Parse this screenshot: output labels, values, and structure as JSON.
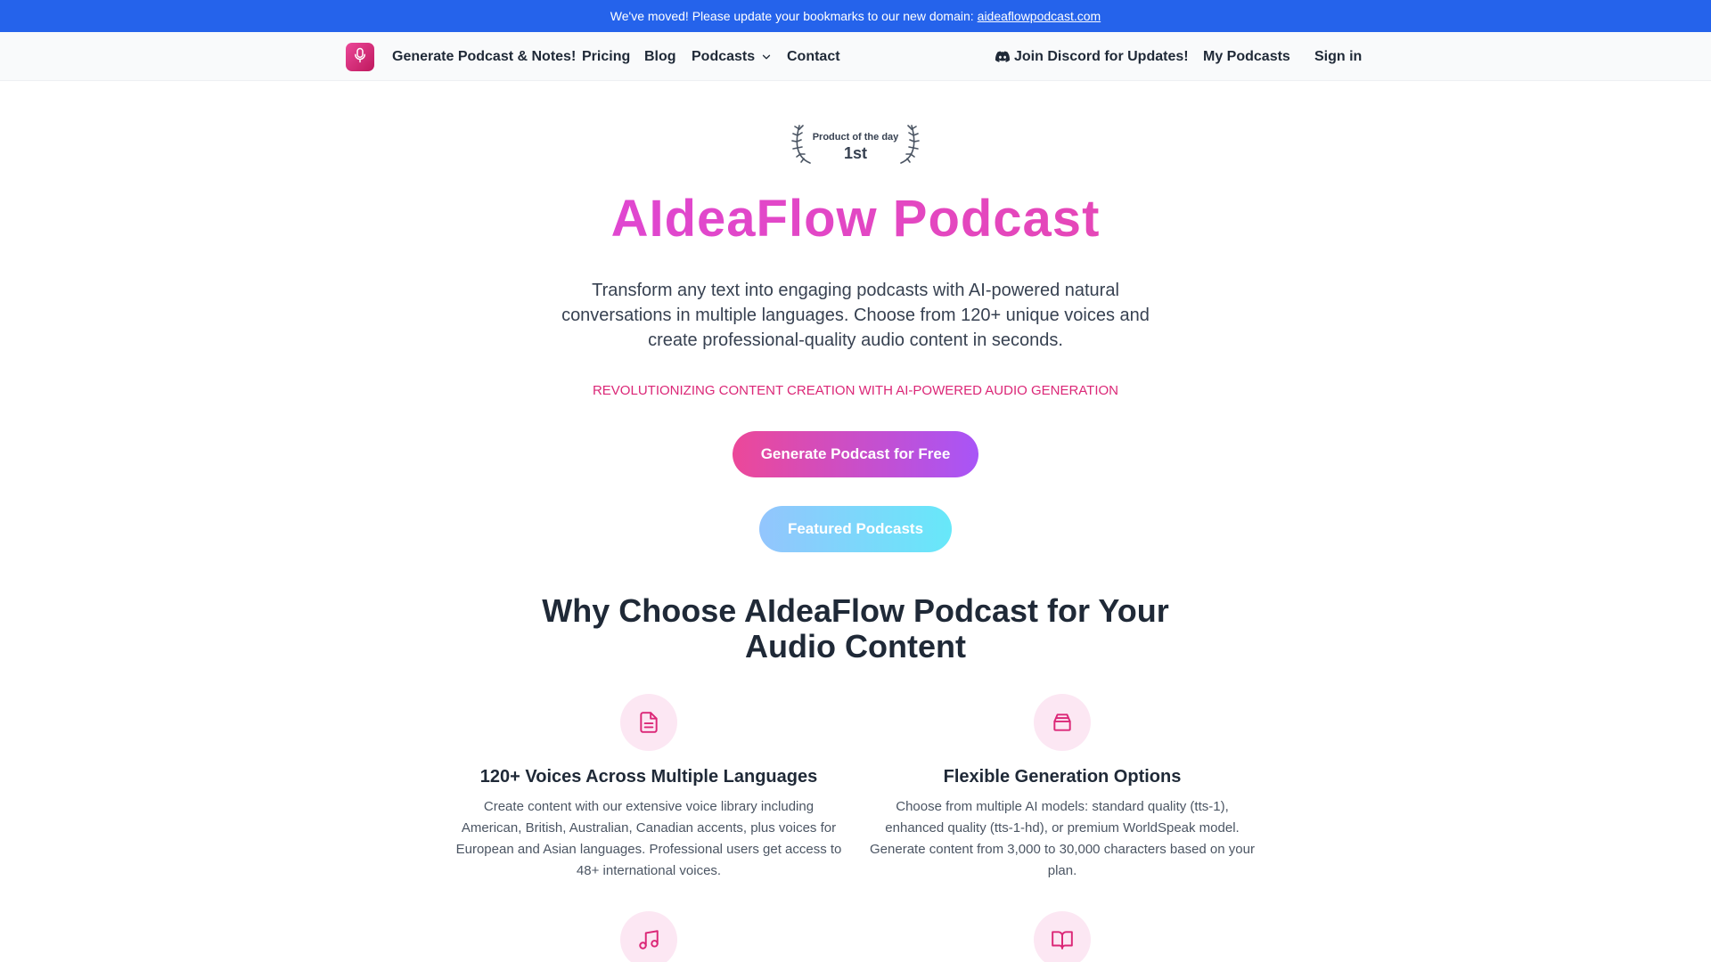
{
  "announcement": {
    "text": "We've moved! Please update your bookmarks to our new domain:",
    "link": "aideaflowpodcast.com"
  },
  "nav": {
    "logo_icon": "microphone-icon",
    "generate": "Generate Podcast & Notes!",
    "pricing": "Pricing",
    "blog": "Blog",
    "podcasts": "Podcasts",
    "contact": "Contact",
    "discord": "Join Discord for Updates!",
    "my_podcasts": "My Podcasts",
    "sign_in": "Sign in"
  },
  "badge": {
    "label": "Product of the day",
    "rank": "1st"
  },
  "hero": {
    "title": "AIdeaFlow Podcast",
    "subtitle": "Transform any text into engaging podcasts with AI-powered natural conversations in multiple languages. Choose from 120+ unique voices and create professional-quality audio content in seconds.",
    "tagline": "REVOLUTIONIZING CONTENT CREATION WITH AI-POWERED AUDIO GENERATION",
    "primary_button": "Generate Podcast for Free",
    "secondary_button": "Featured Podcasts"
  },
  "why": {
    "title": "Why Choose AIdeaFlow Podcast for Your Audio Content"
  },
  "features": [
    {
      "icon": "document-icon",
      "title": "120+ Voices Across Multiple Languages",
      "description": "Create content with our extensive voice library including American, British, Australian, Canadian accents, plus voices for European and Asian languages. Professional users get access to 48+ international voices."
    },
    {
      "icon": "inbox-icon",
      "title": "Flexible Generation Options",
      "description": "Choose from multiple AI models: standard quality (tts-1), enhanced quality (tts-1-hd), or premium WorldSpeak model. Generate content from 3,000 to 30,000 characters based on your plan."
    },
    {
      "icon": "music-note-icon"
    },
    {
      "icon": "open-book-icon"
    }
  ],
  "colors": {
    "announcement_bg": "#2563eb",
    "brand_pink": "#ec4899",
    "brand_purple": "#a855f7",
    "title_magenta": "#d946ef",
    "secondary_blue": "#93c5fd",
    "icon_circle_bg": "#fce7f3"
  }
}
